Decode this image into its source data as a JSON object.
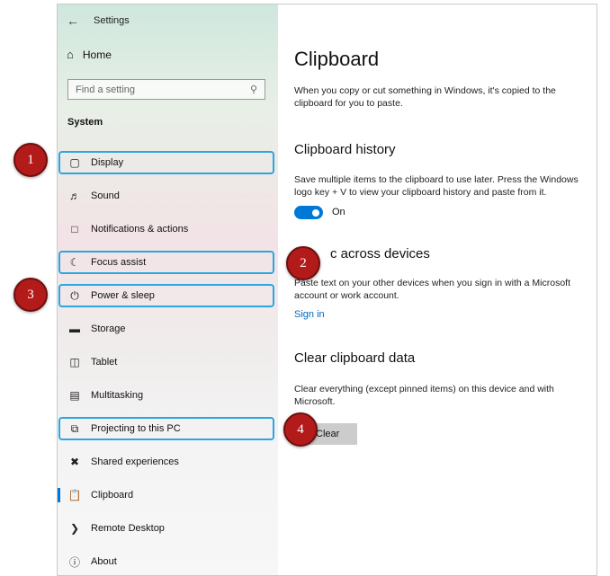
{
  "window": {
    "title": "Settings"
  },
  "sidebar": {
    "home_label": "Home",
    "search_placeholder": "Find a setting",
    "section_title": "System",
    "items": [
      {
        "label": "Display",
        "icon": "monitor-icon"
      },
      {
        "label": "Sound",
        "icon": "speaker-icon"
      },
      {
        "label": "Notifications & actions",
        "icon": "notification-icon"
      },
      {
        "label": "Focus assist",
        "icon": "moon-icon"
      },
      {
        "label": "Power & sleep",
        "icon": "power-icon"
      },
      {
        "label": "Storage",
        "icon": "storage-icon"
      },
      {
        "label": "Tablet",
        "icon": "tablet-icon"
      },
      {
        "label": "Multitasking",
        "icon": "multitasking-icon"
      },
      {
        "label": "Projecting to this PC",
        "icon": "projecting-icon"
      },
      {
        "label": "Shared experiences",
        "icon": "shared-experiences-icon"
      },
      {
        "label": "Clipboard",
        "icon": "clipboard-icon"
      },
      {
        "label": "Remote Desktop",
        "icon": "remote-desktop-icon"
      },
      {
        "label": "About",
        "icon": "info-icon"
      }
    ]
  },
  "main": {
    "title": "Clipboard",
    "intro": "When you copy or cut something in Windows, it's copied to the clipboard for you to paste.",
    "history": {
      "heading": "Clipboard history",
      "description": "Save multiple items to the clipboard to use later. Press the Windows logo key + V to view your clipboard history and paste from it.",
      "toggle_label": "On",
      "toggle_on": true
    },
    "sync": {
      "heading": "c across devices",
      "description": "Paste text on your other devices when you sign in with a Microsoft account or work account.",
      "link_label": "Sign in"
    },
    "clear": {
      "heading": "Clear clipboard data",
      "description": "Clear everything (except pinned items) on this device and with Microsoft.",
      "button_label": "Clear"
    }
  },
  "badges": [
    "1",
    "2",
    "3",
    "4"
  ],
  "colors": {
    "accent": "#0078d7",
    "highlight": "#29a7e1",
    "badge": "#b31b1b"
  }
}
